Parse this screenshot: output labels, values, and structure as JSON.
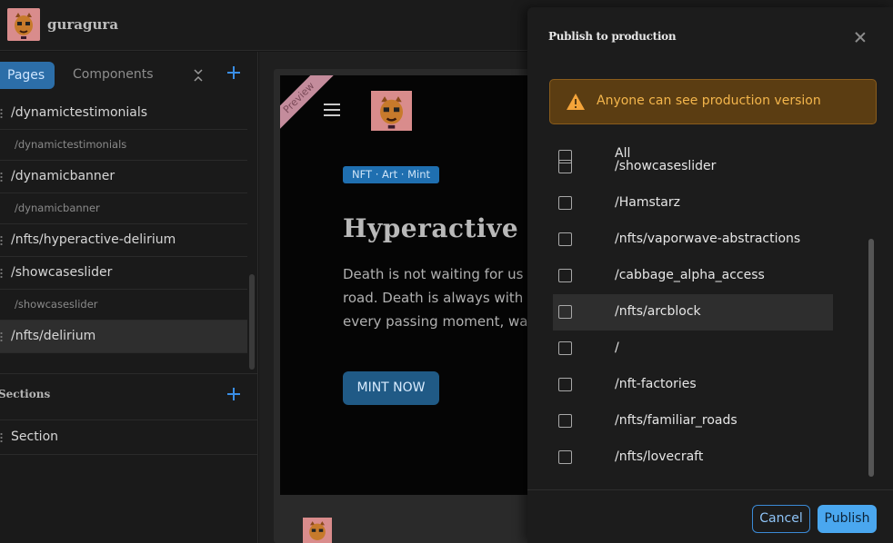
{
  "app": {
    "brand": "guragura"
  },
  "sidebar": {
    "tabs": {
      "pages": "Pages",
      "components": "Components"
    },
    "pages": [
      {
        "type": "main",
        "label": "/dynamictestimonials"
      },
      {
        "type": "sub",
        "label": "/dynamictestimonials"
      },
      {
        "type": "main",
        "label": "/dynamicbanner"
      },
      {
        "type": "sub",
        "label": "/dynamicbanner"
      },
      {
        "type": "main",
        "label": "/nfts/hyperactive-delirium"
      },
      {
        "type": "main",
        "label": "/showcaseslider"
      },
      {
        "type": "sub",
        "label": "/showcaseslider"
      },
      {
        "type": "main",
        "label": "/nfts/delirium",
        "selected": true
      }
    ],
    "sections_title": "Sections",
    "section_item": "Section"
  },
  "preview": {
    "ribbon": "Preview",
    "tag": "NFT · Art · Mint",
    "hero_title": "Hyperactive Delirium",
    "hero_text": "Death is not waiting for us at the end of a long\nroad. Death is always with us, in the marrow of\nevery passing moment, waiting",
    "cta": "MINT NOW"
  },
  "modal": {
    "title": "Publish to production",
    "alert": "Anyone can see production version",
    "select_all": "All",
    "items": [
      "/showcaseslider",
      "/Hamstarz",
      "/nfts/vaporwave-abstractions",
      "/cabbage_alpha_access",
      "/nfts/arcblock",
      "/",
      "/nft-factories",
      "/nfts/familiar_roads",
      "/nfts/lovecraft"
    ],
    "cancel": "Cancel",
    "publish": "Publish"
  },
  "colors": {
    "accent": "#3a8ee6",
    "alert_bg": "#5b3d12",
    "alert_text": "#f4b64c",
    "logo_bg": "#d98c8c"
  }
}
